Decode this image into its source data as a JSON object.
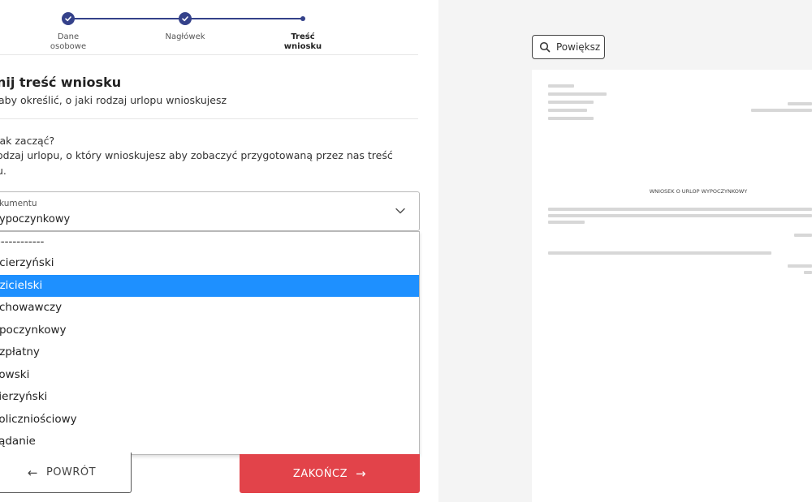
{
  "stepper": {
    "steps": [
      {
        "label_line1": "Dane",
        "label_line2": "osobowe",
        "state": "done"
      },
      {
        "label_line1": "Nagłówek",
        "label_line2": "",
        "state": "done"
      },
      {
        "label_line1": "Treść",
        "label_line2": "wniosku",
        "state": "active"
      }
    ]
  },
  "form": {
    "title": "nij treść wniosku",
    "subtitle": "aby określić, o jaki rodzaj urlopu wnioskujesz",
    "hint_question": " jak zacząć?",
    "hint_line1": "odzaj urlopu, o który wnioskujesz aby zobaczyć przygotowaną przez nas treść",
    "hint_line2": "u.",
    "select": {
      "label": "kumentu",
      "value": "ypoczynkowy",
      "options": [
        "-------------",
        "acierzyński",
        "dzicielski",
        "ychowawczy",
        "ypoczynkowy",
        "ezpłatny",
        "cowski",
        "cierzyński",
        "koliczniościowy",
        " żądanie"
      ],
      "selected_index": 2
    }
  },
  "buttons": {
    "back": "POWRÓT",
    "finish": "ZAKOŃCZ"
  },
  "preview": {
    "zoom_label": "Powiększ",
    "doc_title": "WNIOSEK O URLOP WYPOCZYNKOWY"
  },
  "colors": {
    "accent": "#34418a",
    "selected": "#1e90ff",
    "finish": "#e2434a"
  }
}
